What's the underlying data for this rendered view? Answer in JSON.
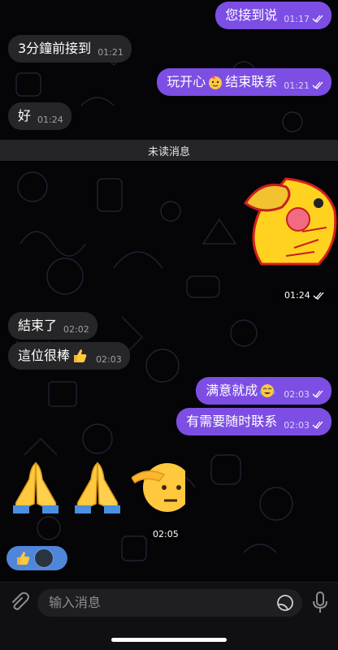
{
  "messages_top": [
    {
      "side": "out",
      "text": "您接到说",
      "time": "01:17"
    },
    {
      "side": "in",
      "text": "3分鐘前接到",
      "time": "01:21"
    },
    {
      "side": "out",
      "text_before": "玩开心",
      "text_after": "结束联系",
      "time": "01:21"
    },
    {
      "side": "in",
      "text": "好",
      "time": "01:24"
    }
  ],
  "unread_label": "未读消息",
  "sticker_time": "01:24",
  "messages_mid": [
    {
      "side": "in",
      "text": "結束了",
      "time": "02:02"
    },
    {
      "side": "in",
      "text": "這位很棒",
      "emoji": "thumbs-up",
      "time": "02:03"
    },
    {
      "side": "out",
      "text": "满意就成",
      "emoji": "tears-of-joy",
      "time": "02:03"
    },
    {
      "side": "out",
      "text": "有需要随时联系",
      "time": "02:03"
    }
  ],
  "emoji_row_time": "02:05",
  "emoji_row": [
    "folded-hands",
    "folded-hands",
    "saluting-face"
  ],
  "reaction": {
    "emoji": "thumbs-up",
    "has_avatar": true
  },
  "composer": {
    "placeholder": "输入消息"
  },
  "colors": {
    "outgoing": "#7c4ee4",
    "incoming": "#262628",
    "reaction": "#4f86d9",
    "background": "#050407"
  }
}
